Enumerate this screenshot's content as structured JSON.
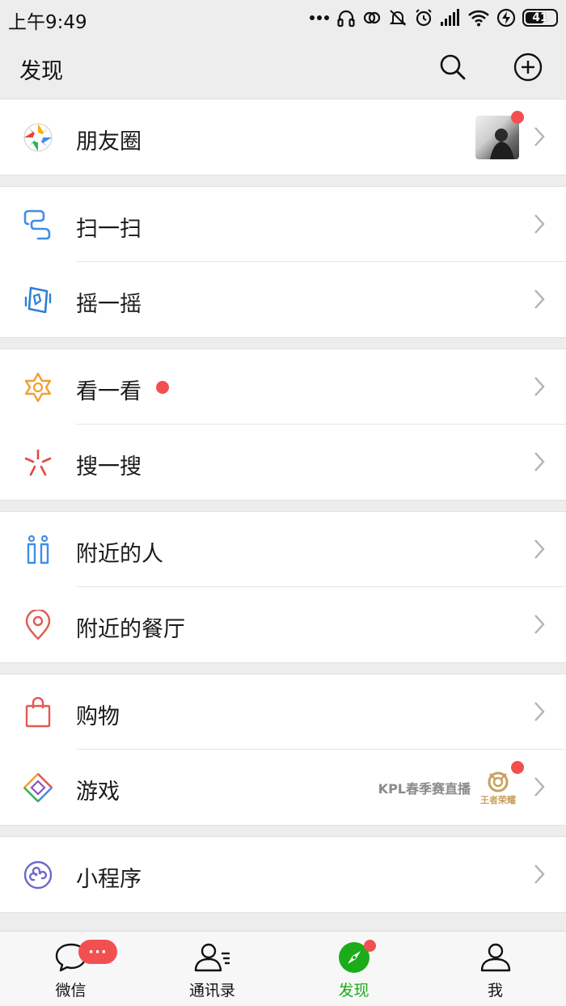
{
  "status_bar": {
    "time": "上午9:49",
    "battery": "41"
  },
  "header": {
    "title": "发现",
    "search_icon": "search-icon",
    "add_icon": "plus-circle-icon"
  },
  "groups": [
    {
      "items": [
        {
          "label": "朋友圈",
          "icon": "moments-icon",
          "has_thumbnail": true,
          "dot": true
        }
      ]
    },
    {
      "items": [
        {
          "label": "扫一扫",
          "icon": "scan-icon"
        },
        {
          "label": "摇一摇",
          "icon": "shake-icon"
        }
      ]
    },
    {
      "items": [
        {
          "label": "看一看",
          "icon": "top-stories-icon",
          "dot": true
        },
        {
          "label": "搜一搜",
          "icon": "search-feature-icon"
        }
      ]
    },
    {
      "items": [
        {
          "label": "附近的人",
          "icon": "people-nearby-icon"
        },
        {
          "label": "附近的餐厅",
          "icon": "location-pin-icon"
        }
      ]
    },
    {
      "items": [
        {
          "label": "购物",
          "icon": "shopping-bag-icon"
        },
        {
          "label": "游戏",
          "icon": "games-icon",
          "promo": "KPL春季赛直播",
          "promo_logo_text": "王者荣耀",
          "dot": true
        }
      ]
    },
    {
      "items": [
        {
          "label": "小程序",
          "icon": "mini-programs-icon"
        }
      ]
    }
  ],
  "tab_bar": {
    "tabs": [
      {
        "label": "微信",
        "icon": "chat-bubble-icon",
        "badge": "···"
      },
      {
        "label": "通讯录",
        "icon": "contacts-icon"
      },
      {
        "label": "发现",
        "icon": "compass-icon",
        "active": true,
        "dot": true
      },
      {
        "label": "我",
        "icon": "person-icon"
      }
    ]
  },
  "colors": {
    "accent_green": "#1aad19",
    "badge_red": "#f25050",
    "background": "#ededed"
  }
}
